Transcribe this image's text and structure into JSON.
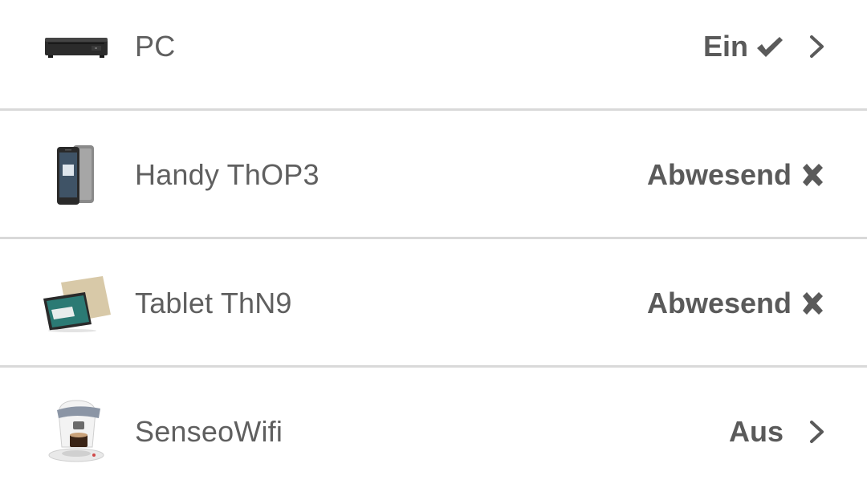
{
  "devices": [
    {
      "name": "PC",
      "status": "Ein",
      "status_icon": "check-icon",
      "has_chevron": true,
      "thumbnail": "desktop-pc-icon"
    },
    {
      "name": "Handy ThOP3",
      "status": "Abwesend",
      "status_icon": "cross-icon",
      "has_chevron": false,
      "thumbnail": "smartphone-icon"
    },
    {
      "name": "Tablet ThN9",
      "status": "Abwesend",
      "status_icon": "cross-icon",
      "has_chevron": false,
      "thumbnail": "tablet-icon"
    },
    {
      "name": "SenseoWifi",
      "status": "Aus",
      "status_icon": "",
      "has_chevron": true,
      "thumbnail": "coffee-machine-icon"
    }
  ],
  "colors": {
    "text": "#5f5f5f",
    "status_text": "#5a5a5a",
    "divider": "#d9d9d9",
    "background": "#ffffff"
  }
}
